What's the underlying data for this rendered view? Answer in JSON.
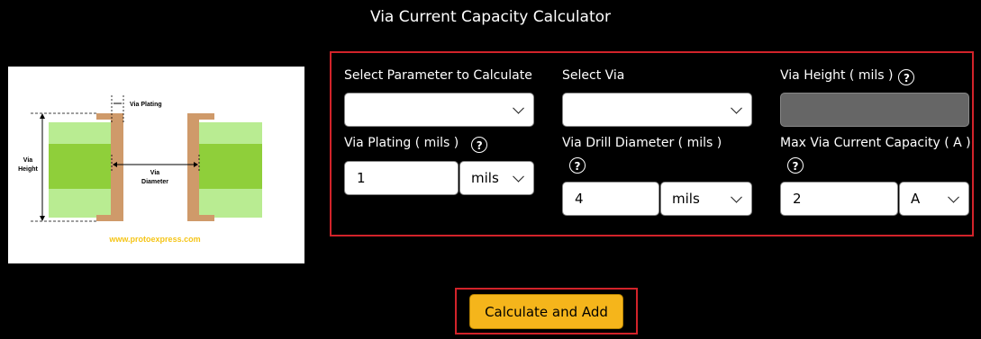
{
  "title": "Via Current Capacity Calculator",
  "diagram": {
    "via_plating_label": "Via Plating",
    "via_height_label_1": "Via",
    "via_height_label_2": "Height",
    "via_diameter_label_1": "Via",
    "via_diameter_label_2": "Diameter",
    "watermark": "www.protoexpress.com"
  },
  "form": {
    "select_parameter": {
      "label": "Select Parameter to Calculate",
      "value": ""
    },
    "select_via": {
      "label": "Select Via",
      "value": ""
    },
    "via_height": {
      "label": "Via Height ( mils )",
      "help": "?",
      "value": ""
    },
    "via_plating": {
      "label": "Via Plating ( mils )",
      "help": "?",
      "value": "1",
      "unit": "mils"
    },
    "via_drill_diameter": {
      "label": "Via Drill Diameter ( mils )",
      "help": "?",
      "value": "4",
      "unit": "mils"
    },
    "max_current": {
      "label": "Max Via Current Capacity ( A )",
      "help": "?",
      "value": "2",
      "unit": "A"
    }
  },
  "calculate_button": "Calculate and Add",
  "colors": {
    "panel_border": "#d2232a",
    "button_bg": "#f5b51b"
  }
}
